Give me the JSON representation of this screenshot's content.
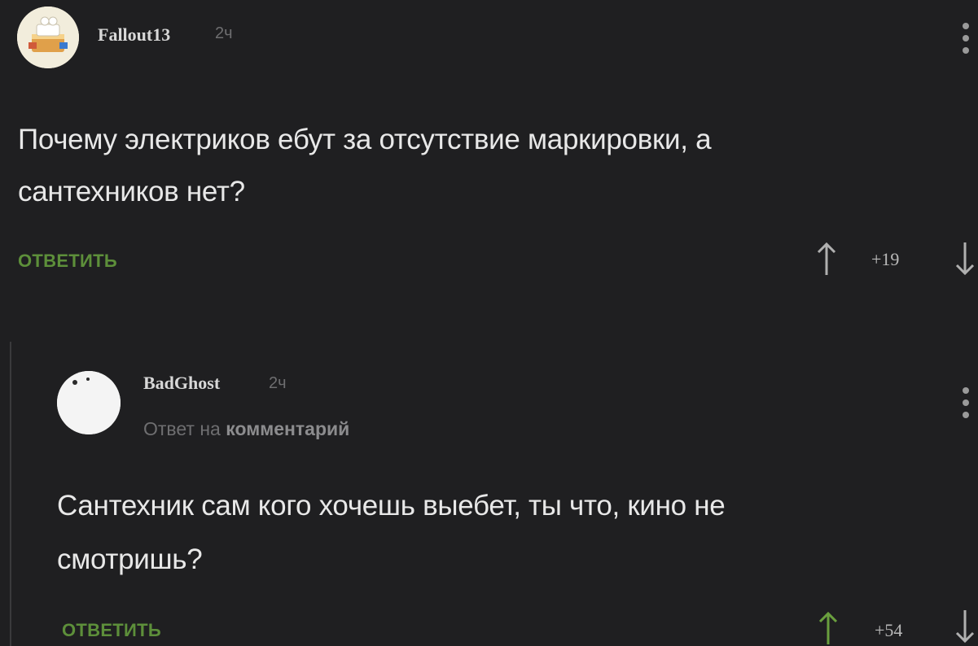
{
  "comments": [
    {
      "username": "Fallout13",
      "time": "2ч",
      "text_line1": "Почему электриков ебут за отсутствие маркировки, а",
      "text_line2": "сантехников нет?",
      "reply_label": "ОТВЕТИТЬ",
      "score": "+19",
      "avatar_icon": "cake-avatar-icon"
    },
    {
      "username": "BadGhost",
      "time": "2ч",
      "reply_to_prefix": "Ответ на",
      "reply_to_target": "комментарий",
      "text_line1": "Сантехник сам кого хочешь выебет, ты что, кино не",
      "text_line2": "смотришь?",
      "reply_label": "ОТВЕТИТЬ",
      "score": "+54",
      "avatar_icon": "ghost-avatar-icon"
    }
  ],
  "colors": {
    "background": "#1f1f21",
    "reply_link": "#5d8f3a",
    "muted": "#6e6e70"
  }
}
